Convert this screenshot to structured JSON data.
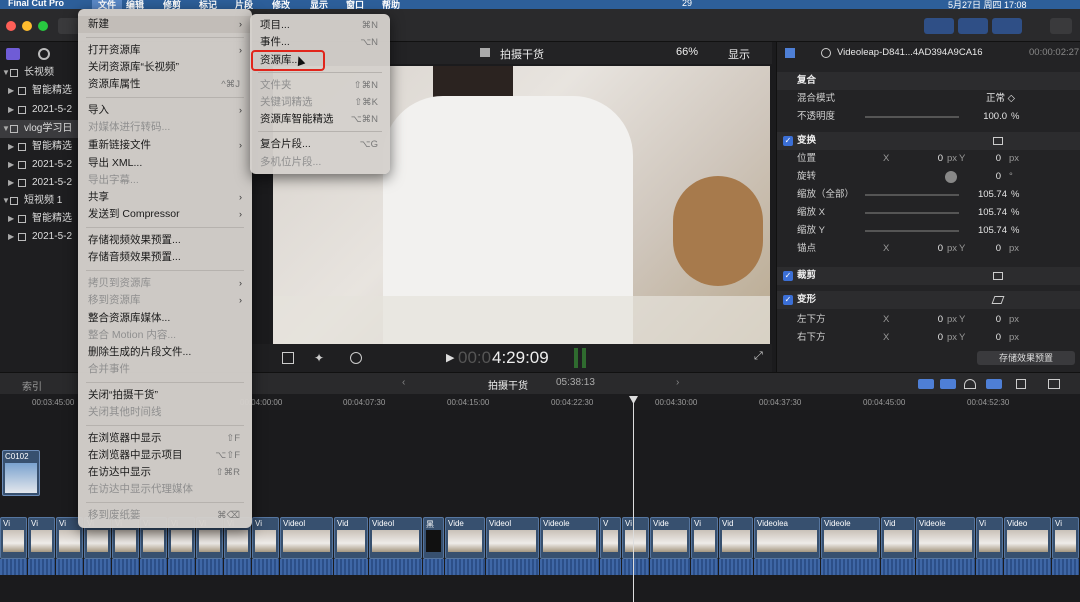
{
  "menubar": {
    "app": "Final Cut Pro",
    "items": [
      "文件",
      "编辑",
      "修剪",
      "标记",
      "片段",
      "修改",
      "显示",
      "窗口",
      "帮助"
    ],
    "battery_num": "29",
    "datetime": "5月27日 周四 17:08"
  },
  "file_menu": {
    "items": [
      {
        "label": "新建",
        "shortcut": "",
        "submenu": true,
        "disabled": false
      },
      {
        "label": "打开资源库",
        "shortcut": "",
        "submenu": true,
        "disabled": false
      },
      {
        "label": "关闭资源库“长视频”",
        "shortcut": "",
        "submenu": false,
        "disabled": false
      },
      {
        "label": "资源库属性",
        "shortcut": "^⌘J",
        "submenu": false,
        "disabled": false
      },
      {
        "label": "导入",
        "shortcut": "",
        "submenu": true,
        "disabled": false
      },
      {
        "label": "对媒体进行转码...",
        "shortcut": "",
        "submenu": false,
        "disabled": true
      },
      {
        "label": "重新链接文件",
        "shortcut": "",
        "submenu": true,
        "disabled": false
      },
      {
        "label": "导出 XML...",
        "shortcut": "",
        "submenu": false,
        "disabled": false
      },
      {
        "label": "导出字幕...",
        "shortcut": "",
        "submenu": false,
        "disabled": true
      },
      {
        "label": "共享",
        "shortcut": "",
        "submenu": true,
        "disabled": false
      },
      {
        "label": "发送到 Compressor",
        "shortcut": "",
        "submenu": true,
        "disabled": false
      },
      {
        "label": "存储视频效果预置...",
        "shortcut": "",
        "submenu": false,
        "disabled": false
      },
      {
        "label": "存储音频效果预置...",
        "shortcut": "",
        "submenu": false,
        "disabled": false
      },
      {
        "label": "拷贝到资源库",
        "shortcut": "",
        "submenu": true,
        "disabled": true
      },
      {
        "label": "移到资源库",
        "shortcut": "",
        "submenu": true,
        "disabled": true
      },
      {
        "label": "整合资源库媒体...",
        "shortcut": "",
        "submenu": false,
        "disabled": false
      },
      {
        "label": "整合 Motion 内容...",
        "shortcut": "",
        "submenu": false,
        "disabled": true
      },
      {
        "label": "删除生成的片段文件...",
        "shortcut": "",
        "submenu": false,
        "disabled": false
      },
      {
        "label": "合并事件",
        "shortcut": "",
        "submenu": false,
        "disabled": true
      },
      {
        "label": "关闭“拍摄干货”",
        "shortcut": "",
        "submenu": false,
        "disabled": false
      },
      {
        "label": "关闭其他时间线",
        "shortcut": "",
        "submenu": false,
        "disabled": true
      },
      {
        "label": "在浏览器中显示",
        "shortcut": "⇧F",
        "submenu": false,
        "disabled": false
      },
      {
        "label": "在浏览器中显示项目",
        "shortcut": "⌥⇧F",
        "submenu": false,
        "disabled": false
      },
      {
        "label": "在访达中显示",
        "shortcut": "⇧⌘R",
        "submenu": false,
        "disabled": false
      },
      {
        "label": "在访达中显示代理媒体",
        "shortcut": "",
        "submenu": false,
        "disabled": true
      },
      {
        "label": "移到废纸篓",
        "shortcut": "⌘⌫",
        "submenu": false,
        "disabled": true
      }
    ]
  },
  "new_submenu": {
    "items": [
      {
        "label": "项目...",
        "shortcut": "⌘N",
        "disabled": false
      },
      {
        "label": "事件...",
        "shortcut": "⌥N",
        "disabled": false
      },
      {
        "label": "资源库...",
        "shortcut": "",
        "disabled": false
      },
      {
        "label": "文件夹",
        "shortcut": "⇧⌘N",
        "disabled": true
      },
      {
        "label": "关键词精选",
        "shortcut": "⇧⌘K",
        "disabled": true
      },
      {
        "label": "资源库智能精选",
        "shortcut": "⌥⌘N",
        "disabled": false
      },
      {
        "label": "复合片段...",
        "shortcut": "⌥G",
        "disabled": false
      },
      {
        "label": "多机位片段...",
        "shortcut": "",
        "disabled": true
      }
    ]
  },
  "browser": {
    "rows": [
      "长视频",
      "智能精选",
      "2021-5-2",
      "vlog学习日",
      "智能精选",
      "2021-5-2",
      "2021-5-2",
      "短视频 1",
      "智能精选",
      "2021-5-2"
    ]
  },
  "viewer": {
    "title": "拍摄干货",
    "zoom": "66%",
    "display_menu": "显示",
    "timecode_dim": "00:0",
    "timecode": "4:29:09"
  },
  "inspector": {
    "clip_name": "Videoleap-D841...4AD394A9CA16",
    "duration": "00:00:02:27",
    "composite": {
      "title": "复合",
      "blend_label": "混合模式",
      "blend_value": "正常 ◇",
      "opacity_label": "不透明度",
      "opacity_value": "100.0",
      "opacity_unit": "%"
    },
    "transform": {
      "title": "变换",
      "position_label": "位置",
      "position_x": "0",
      "position_y": "0",
      "rotation_label": "旋转",
      "rotation_value": "0",
      "scale_all_label": "缩放（全部）",
      "scale_all": "105.74",
      "scale_x_label": "缩放 X",
      "scale_x": "105.74",
      "scale_y_label": "缩放 Y",
      "scale_y": "105.74",
      "anchor_label": "锚点",
      "anchor_x": "0",
      "anchor_y": "0"
    },
    "crop_title": "裁剪",
    "distort": {
      "title": "变形",
      "bl_label": "左下方",
      "bl_x": "0",
      "bl_y": "0",
      "br_label": "右下方",
      "br_x": "0",
      "br_y": "0"
    },
    "unit_px": "px",
    "unit_deg": "°",
    "unit_pct": "%",
    "axis_x": "X",
    "axis_y": "Y",
    "save_preset": "存储效果预置"
  },
  "timeline": {
    "index_tab": "索引",
    "project": "拍摄干货",
    "duration": "05:38:13",
    "ruler": [
      "00:03:45:00",
      "00:04:00:00",
      "00:04:07:30",
      "00:04:15:00",
      "00:04:22:30",
      "00:04:30:00",
      "00:04:37:30",
      "00:04:45:00",
      "00:04:52:30"
    ],
    "connected_clip": "C0102",
    "clip_labels": [
      "Vi",
      "Vi",
      "Vi",
      "Vi",
      "Vi",
      "Vi",
      "Vi",
      "Vi",
      "Vi",
      "Vi",
      "Videol",
      "Vid",
      "Videol",
      "黑",
      "Vide",
      "Videol",
      "Videole",
      "V",
      "Vi",
      "Vide",
      "Vi",
      "Vid",
      "Videoleа",
      "Videole",
      "Vid",
      "Videole",
      "Vi",
      "Video",
      "Vi"
    ]
  }
}
